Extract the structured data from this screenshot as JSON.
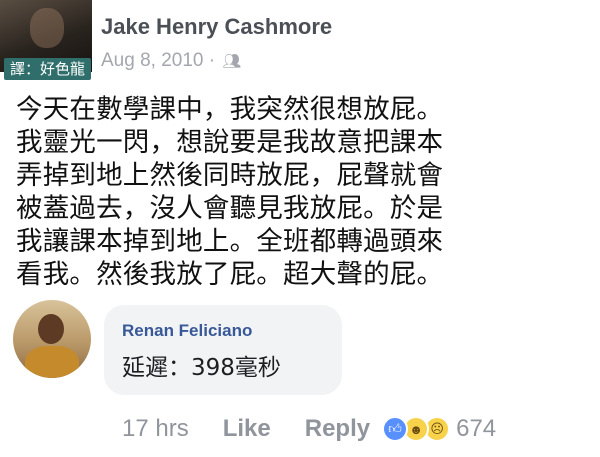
{
  "post": {
    "author": "Jake Henry Cashmore",
    "date": "Aug 8, 2010",
    "separator": "·",
    "privacy_icon": "people-icon",
    "translator_tag": "譯：好色龍",
    "body_lines": [
      "今天在數學課中，我突然很想放屁。",
      "我靈光一閃，想說要是我故意把課本",
      "弄掉到地上然後同時放屁，屁聲就會",
      "被蓋過去，沒人會聽見我放屁。於是",
      "我讓課本掉到地上。全班都轉過頭來",
      "看我。然後我放了屁。超大聲的屁。"
    ]
  },
  "comment": {
    "author": "Renan Feliciano",
    "text": "延遲：398毫秒",
    "time": "17 hrs",
    "like_label": "Like",
    "reply_label": "Reply",
    "reactions": [
      "like-icon",
      "haha-icon",
      "sad-icon"
    ],
    "reaction_count": "674"
  },
  "colors": {
    "author_gray": "#4b4f56",
    "commenter_blue": "#385898",
    "meta_gray": "#90949c",
    "bubble_bg": "#f2f3f5",
    "like_blue": "#5890ff"
  }
}
